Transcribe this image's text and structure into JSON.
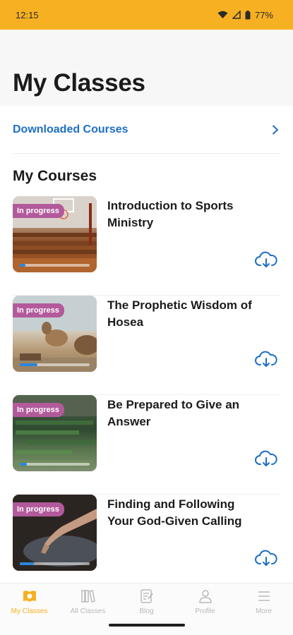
{
  "status_bar": {
    "time": "12:15",
    "battery": "77%"
  },
  "header": {
    "title": "My Classes"
  },
  "downloaded": {
    "label": "Downloaded Courses"
  },
  "section": {
    "title": "My Courses"
  },
  "courses": [
    {
      "title": "Introduction to Sports Ministry",
      "badge": "In progress",
      "progress": 0.08
    },
    {
      "title": "The Prophetic Wisdom of Hosea",
      "badge": "In progress",
      "progress": 0.25
    },
    {
      "title": "Be Prepared to Give an Answer",
      "badge": "In progress",
      "progress": 0.1
    },
    {
      "title": "Finding and Following Your God-Given Calling",
      "badge": "In progress",
      "progress": 0.2
    }
  ],
  "nav": [
    {
      "label": "My Classes",
      "icon": "book-open-icon",
      "active": true
    },
    {
      "label": "All Classes",
      "icon": "books-icon",
      "active": false
    },
    {
      "label": "Blog",
      "icon": "blog-icon",
      "active": false
    },
    {
      "label": "Profile",
      "icon": "profile-icon",
      "active": false
    },
    {
      "label": "More",
      "icon": "menu-icon",
      "active": false
    }
  ],
  "colors": {
    "accent": "#f7b022",
    "link": "#1e6fc4",
    "badge": "#b25a9b",
    "progress": "#2b86d8"
  }
}
